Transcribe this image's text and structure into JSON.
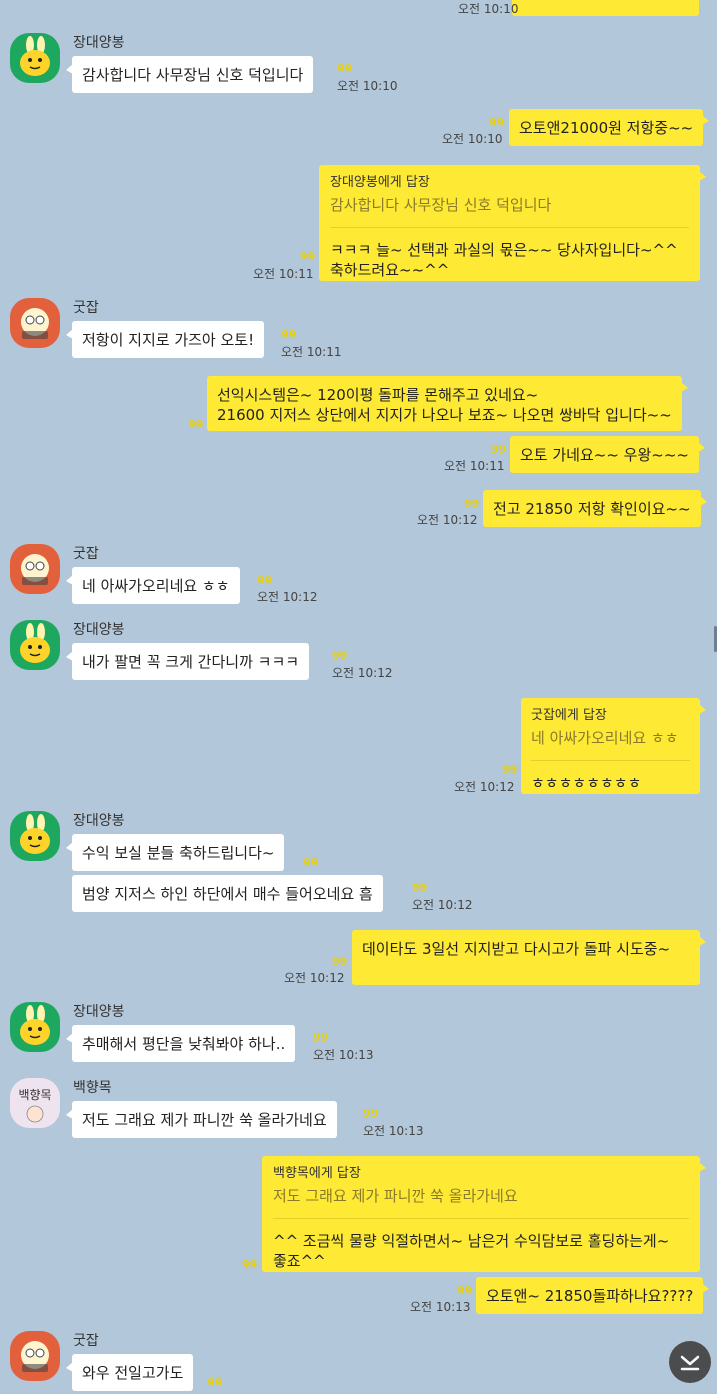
{
  "users": {
    "jangdae": "장대양봉",
    "gutjab": "굿잡",
    "baek": "백향목"
  },
  "avatars": {
    "baek_text": "백향목"
  },
  "unread": "99",
  "messages": {
    "m0": {
      "time": "오전 10:10"
    },
    "m1": {
      "text": "감사합니다 사무장님 신호 덕입니다",
      "time": "오전 10:10"
    },
    "m2": {
      "text": "오토앤21000원 저항중~~",
      "time": "오전 10:10"
    },
    "m3": {
      "reply_title": "장대양봉에게 답장",
      "reply_quote": "감사합니다 사무장님 신호 덕입니다",
      "line1": "ㅋㅋㅋ 늘~ 선택과 과실의 몫은~~ 당사자입니다~^^",
      "line2": "축하드려요~~^^",
      "time": "오전 10:11"
    },
    "m4": {
      "text": "저항이 지지로 가즈아 오토!",
      "time": "오전 10:11"
    },
    "m5": {
      "line1": "선익시스템은~ 120이평 돌파를 몬해주고 있네요~",
      "line2": "21600 지저스 상단에서 지지가 나오나 보죠~ 나오면 쌍바닥 입니다~~"
    },
    "m6": {
      "text": "오토 가네요~~ 우왕~~~",
      "time": "오전 10:11"
    },
    "m7": {
      "text": "전고 21850 저항 확인이요~~",
      "time": "오전 10:12"
    },
    "m8": {
      "text": "네 아싸가오리네요 ㅎㅎ",
      "time": "오전 10:12"
    },
    "m9": {
      "text": "내가 팔면 꼭 크게 간다니까 ㅋㅋㅋ",
      "time": "오전 10:12"
    },
    "m10": {
      "reply_title": "굿잡에게 답장",
      "reply_quote": "네 아싸가오리네요 ㅎㅎ",
      "line1": "ㅎㅎㅎㅎㅎㅎㅎㅎ",
      "time": "오전 10:12"
    },
    "m11": {
      "text": "수익 보실 분들 축하드립니다~"
    },
    "m12": {
      "text": "범양 지저스 하인 하단에서 매수 들어오네요 흠",
      "time": "오전 10:12"
    },
    "m13": {
      "text": "데이타도 3일선 지지받고 다시고가 돌파 시도중~",
      "time": "오전 10:12"
    },
    "m14": {
      "text": "추매해서 평단을 낮춰봐야 하나..",
      "time": "오전 10:13"
    },
    "m15": {
      "text": "저도 그래요 제가 파니깐 쑥 올라가네요",
      "time": "오전 10:13"
    },
    "m16": {
      "reply_title": "백향목에게 답장",
      "reply_quote": "저도 그래요 제가 파니깐 쑥 올라가네요",
      "line1": "^^ 조금씩 물량 익절하면서~ 남은거 수익담보로 홀딩하는게~",
      "line2": "좋죠^^"
    },
    "m17": {
      "text": "오토앤~ 21850돌파하나요????",
      "time": "오전 10:13"
    },
    "m18": {
      "text": "와우 전일고가도"
    }
  },
  "colors": {
    "background": "#b2c7d9",
    "my_bubble": "#fee934",
    "other_bubble": "#ffffff",
    "unread": "#e6cf14"
  },
  "icons": {
    "scroll_down": "chevron-down-bar-icon"
  }
}
